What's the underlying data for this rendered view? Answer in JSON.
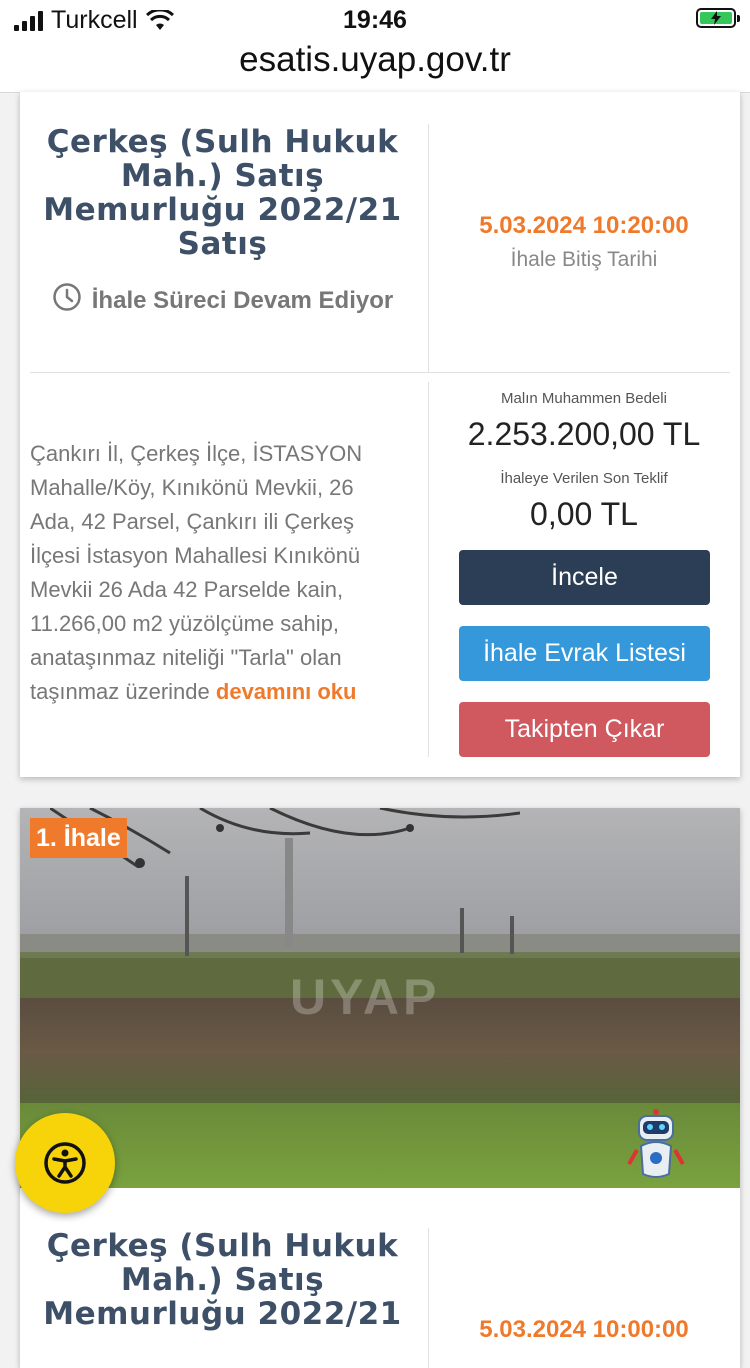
{
  "status_bar": {
    "carrier": "Turkcell",
    "time": "19:46",
    "icons": [
      "signal-icon",
      "wifi-icon",
      "battery-charging-icon"
    ]
  },
  "browser": {
    "url": "esatis.uyap.gov.tr"
  },
  "listing1": {
    "title": "Çerkeş (Sulh Hukuk Mah.) Satış Memurluğu 2022/21 Satış",
    "status": "İhale Süreci Devam Ediyor",
    "end_date": "5.03.2024 10:20:00",
    "end_date_label": "İhale Bitiş Tarihi",
    "description": "Çankırı İl, Çerkeş İlçe, İSTASYON Mahalle/Köy, Kınıkönü Mevkii, 26 Ada, 42 Parsel, Çankırı ili Çerkeş İlçesi İstasyon Mahallesi Kınıkönü Mevkii 26 Ada 42 Parselde kain, 11.266,00 m2 yüzölçüme sahip, anataşınmaz niteliği \"Tarla\" olan taşınmaz üzerinde",
    "read_more": "devamını oku",
    "estimated_value_label": "Malın Muhammen Bedeli",
    "estimated_value": "2.253.200,00 TL",
    "last_bid_label": "İhaleye Verilen Son Teklif",
    "last_bid": "0,00 TL",
    "buttons": {
      "inspect": "İncele",
      "documents": "İhale Evrak Listesi",
      "unfollow": "Takipten Çıkar"
    }
  },
  "listing2": {
    "badge": "1. İhale",
    "watermark": "UYAP",
    "title": "Çerkeş (Sulh Hukuk Mah.) Satış Memurluğu 2022/21",
    "end_date": "5.03.2024 10:00:00"
  },
  "colors": {
    "accent_orange": "#f07a2c",
    "dark_button": "#2c3e56",
    "blue_button": "#3498db",
    "red_button": "#d0585f",
    "accessibility_yellow": "#f6d409"
  }
}
